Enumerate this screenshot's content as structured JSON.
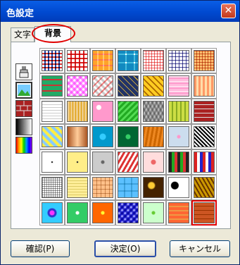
{
  "window": {
    "title": "色設定",
    "close_glyph": "✕"
  },
  "tabs": [
    {
      "label": "文字",
      "selected": false
    },
    {
      "label": "背景",
      "selected": true
    }
  ],
  "sidebar": {
    "items": [
      {
        "name": "brush-icon",
        "selected": false
      },
      {
        "name": "picture-icon",
        "selected": true
      },
      {
        "name": "brick-icon",
        "selected": false
      },
      {
        "name": "gradient-icon",
        "selected": false
      },
      {
        "name": "rainbow-icon",
        "selected": false
      }
    ]
  },
  "patterns": [
    {
      "bg": "repeating-linear-gradient(0deg,#fff 0 3px,#d33 3px 5px),repeating-linear-gradient(90deg,#fff 0 3px,#24a 3px 5px)",
      "blend": true
    },
    {
      "bg": "repeating-linear-gradient(0deg,#fff 0 4px,#d22 4px 6px),repeating-linear-gradient(90deg,#fff 0 4px,#d22 4px 6px)",
      "blend": true
    },
    {
      "bg": "repeating-linear-gradient(0deg,#fc6 0 6px,#f9a 6px 8px),repeating-linear-gradient(90deg,#fc6 0 6px,#fff 6px 8px)",
      "blend": true
    },
    {
      "bg": "repeating-linear-gradient(0deg,#4bd 0 10px,#fff 10px 12px),repeating-linear-gradient(90deg,#4bd 0 10px,#fff 10px 12px)",
      "blend": true
    },
    {
      "bg": "repeating-linear-gradient(0deg,#fff 0 3px,#e66 3px 4px),repeating-linear-gradient(90deg,#fff 0 3px,#e66 3px 4px)",
      "blend": true
    },
    {
      "bg": "repeating-linear-gradient(0deg,#fff 0 4px,#449 4px 5px),repeating-linear-gradient(90deg,#fff 0 4px,#449 4px 5px)",
      "blend": true
    },
    {
      "bg": "repeating-linear-gradient(0deg,#fda 0 3px,#c63 3px 4px),repeating-linear-gradient(90deg,#fda 0 3px,#c63 3px 4px)",
      "blend": true
    },
    {
      "bg": "repeating-linear-gradient(0deg,#2a6 0 6px,#c33 6px 8px),repeating-linear-gradient(90deg,#2a6 0 6px,#c33 6px 8px)",
      "blend": false
    },
    {
      "bg": "repeating-linear-gradient(45deg,#f9f 0 3px,#fff 3px 6px),repeating-linear-gradient(-45deg,#f9f 0 3px,#fff 3px 6px)",
      "blend": true
    },
    {
      "bg": "repeating-linear-gradient(45deg,#ccc 0 3px,#fff 3px 6px),repeating-linear-gradient(-45deg,#f88 0 2px,#fff 2px 7px)",
      "blend": true
    },
    {
      "bg": "repeating-linear-gradient(45deg,#236 0 5px,#fc3 5px 6px),repeating-linear-gradient(-45deg,#236 0 5px,#fc3 5px 6px)",
      "blend": false
    },
    {
      "bg": "repeating-linear-gradient(45deg,#fc2 0 4px,#a60 4px 6px),repeating-linear-gradient(-45deg,#fc2 0 4px,#a60 4px 6px)",
      "blend": false
    },
    {
      "bg": "repeating-linear-gradient(0deg,#fbd 0 3px,#f9c 3px 5px,#fde 5px 7px)",
      "blend": false
    },
    {
      "bg": "repeating-linear-gradient(90deg,#f96 0 3px,#fda 3px 6px)",
      "blend": false
    },
    {
      "bg": "repeating-linear-gradient(0deg,#fff 0 3px,#ccc 3px 4px)",
      "blend": false
    },
    {
      "bg": "repeating-linear-gradient(90deg,#ec8 0 3px,#d90 3px 4px)",
      "blend": false
    },
    {
      "bg": "radial-gradient(circle at 30% 30%,#fff 0 3px,#f9c 4px)",
      "blend": false
    },
    {
      "bg": "repeating-linear-gradient(135deg,#2a2 0 3px,#5d5 3px 6px)",
      "blend": false
    },
    {
      "bg": "repeating-linear-gradient(60deg,#bbb 0 3px,#888 3px 5px),repeating-linear-gradient(-60deg,#bbb 0 3px,#fff 3px 5px)",
      "blend": true
    },
    {
      "bg": "repeating-linear-gradient(90deg,#cd4 0 4px,#8a2 4px 6px)",
      "blend": false
    },
    {
      "bg": "repeating-linear-gradient(0deg,#a22 0 5px,#ddd 5px 6px),repeating-linear-gradient(90deg,#a22 0 10px,#ddd 10px 11px)",
      "blend": false
    },
    {
      "bg": "repeating-linear-gradient(45deg,#fe4 0 4px,#8cf 4px 8px)",
      "blend": false
    },
    {
      "bg": "linear-gradient(90deg,#a52 0%,#fc9 50%,#a52 100%)",
      "blend": false
    },
    {
      "bg": "radial-gradient(circle,#3cf 0 4px,#09c 5px)",
      "blend": false
    },
    {
      "bg": "radial-gradient(circle,#3c6 0 3px,#063 4px)",
      "blend": false
    },
    {
      "bg": "repeating-linear-gradient(100deg,#c60 0 3px,#e82 3px 6px)",
      "blend": false
    },
    {
      "bg": "radial-gradient(circle,#f9c 0 2px,#cde 3px)",
      "blend": false
    },
    {
      "bg": "repeating-linear-gradient(45deg,#000 0 2px,#fff 2px 4px)",
      "blend": false
    },
    {
      "bg": "radial-gradient(circle,#333 0 1px,#fff 1.5px)",
      "blend": false
    },
    {
      "bg": "radial-gradient(circle,#333 0 1px,#fe8 1.5px)",
      "blend": false
    },
    {
      "bg": "radial-gradient(circle,#666 0 2px,#ccc 3px)",
      "blend": false
    },
    {
      "bg": "repeating-linear-gradient(120deg,#d33 0 3px,#fff 3px 6px)",
      "blend": false
    },
    {
      "bg": "radial-gradient(circle,#e66 0 3px,#fdd 4px)",
      "blend": false
    },
    {
      "bg": "repeating-linear-gradient(90deg,#222 0 4px,#2a2 4px 8px,#d33 8px 12px)",
      "blend": false
    },
    {
      "bg": "repeating-linear-gradient(90deg,#d22 0 4px,#fff 4px 8px,#22c 8px 12px)",
      "blend": false
    },
    {
      "bg": "repeating-linear-gradient(0deg,#999 0 1px,#fff 1px 3px),repeating-linear-gradient(90deg,#999 0 1px,#fff 1px 3px)",
      "blend": true
    },
    {
      "bg": "repeating-linear-gradient(0deg,#fe9 0 3px,#dc6 3px 4px)",
      "blend": false
    },
    {
      "bg": "repeating-linear-gradient(0deg,#fdb 0 5px,#c96 5px 6px),repeating-linear-gradient(90deg,#fdb 0 5px,#c96 5px 6px)",
      "blend": true
    },
    {
      "bg": "repeating-linear-gradient(0deg,#9df 0 8px,#6bd 8px 10px),repeating-linear-gradient(90deg,#9df 0 8px,#6bd 8px 10px)",
      "blend": true
    },
    {
      "bg": "radial-gradient(ellipse at 40% 40%,#fc3 0 4px,#420 6px)",
      "blend": false
    },
    {
      "bg": "radial-gradient(circle at 30% 40%,#000 0 5px,#fff 6px)",
      "blend": false
    },
    {
      "bg": "repeating-linear-gradient(60deg,#c90 0 3px,#630 3px 5px)",
      "blend": false
    },
    {
      "bg": "radial-gradient(circle,#f3f 0 3px,#33c 4px 6px,#3cf 7px)",
      "blend": false
    },
    {
      "bg": "radial-gradient(circle,#fff 0 2px,#3c6 3px)",
      "blend": false
    },
    {
      "bg": "radial-gradient(circle,#ff3 0 2px,#f60 3px)",
      "blend": false
    },
    {
      "bg": "repeating-linear-gradient(45deg,#33c 0 3px,#99f 3px 6px),repeating-linear-gradient(-45deg,#33c 0 3px,#fff 3px 6px)",
      "blend": true
    },
    {
      "bg": "radial-gradient(circle,#6c3 0 2px,#cfc 3px)",
      "blend": false
    },
    {
      "bg": "repeating-linear-gradient(0deg,#f63 0 4px,#e94 4px 6px)",
      "blend": false
    },
    {
      "bg": "repeating-linear-gradient(0deg,#c52 0 5px,#930 5px 6px)",
      "blend": false
    }
  ],
  "selected_pattern": 48,
  "buttons": {
    "confirm": "確認(P)",
    "ok": "決定(O)",
    "cancel": "キャンセル"
  }
}
